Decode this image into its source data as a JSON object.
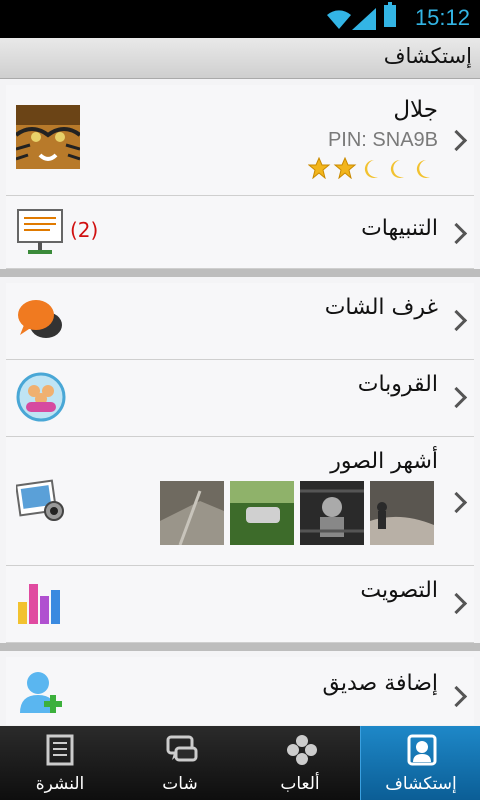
{
  "status_bar": {
    "time": "15:12"
  },
  "header": {
    "title": "إستكشاف"
  },
  "profile": {
    "name": "جلال",
    "pin": "PIN: SNA9B",
    "rating": {
      "stars": 2,
      "moons": 3
    }
  },
  "notifications": {
    "label": "التنبيهات",
    "count": "(2)"
  },
  "menu": {
    "chat_rooms": "غرف الشات",
    "groups": "القروبات",
    "popular_photos": "أشهر الصور",
    "voting": "التصويت",
    "add_friend": "إضافة صديق"
  },
  "tabs": [
    {
      "label": "النشرة"
    },
    {
      "label": "شات"
    },
    {
      "label": "ألعاب"
    },
    {
      "label": "إستكشاف",
      "active": true
    }
  ],
  "colors": {
    "accent": "#33b5e5",
    "active_tab": "#1374b6",
    "badge": "#d01010"
  }
}
